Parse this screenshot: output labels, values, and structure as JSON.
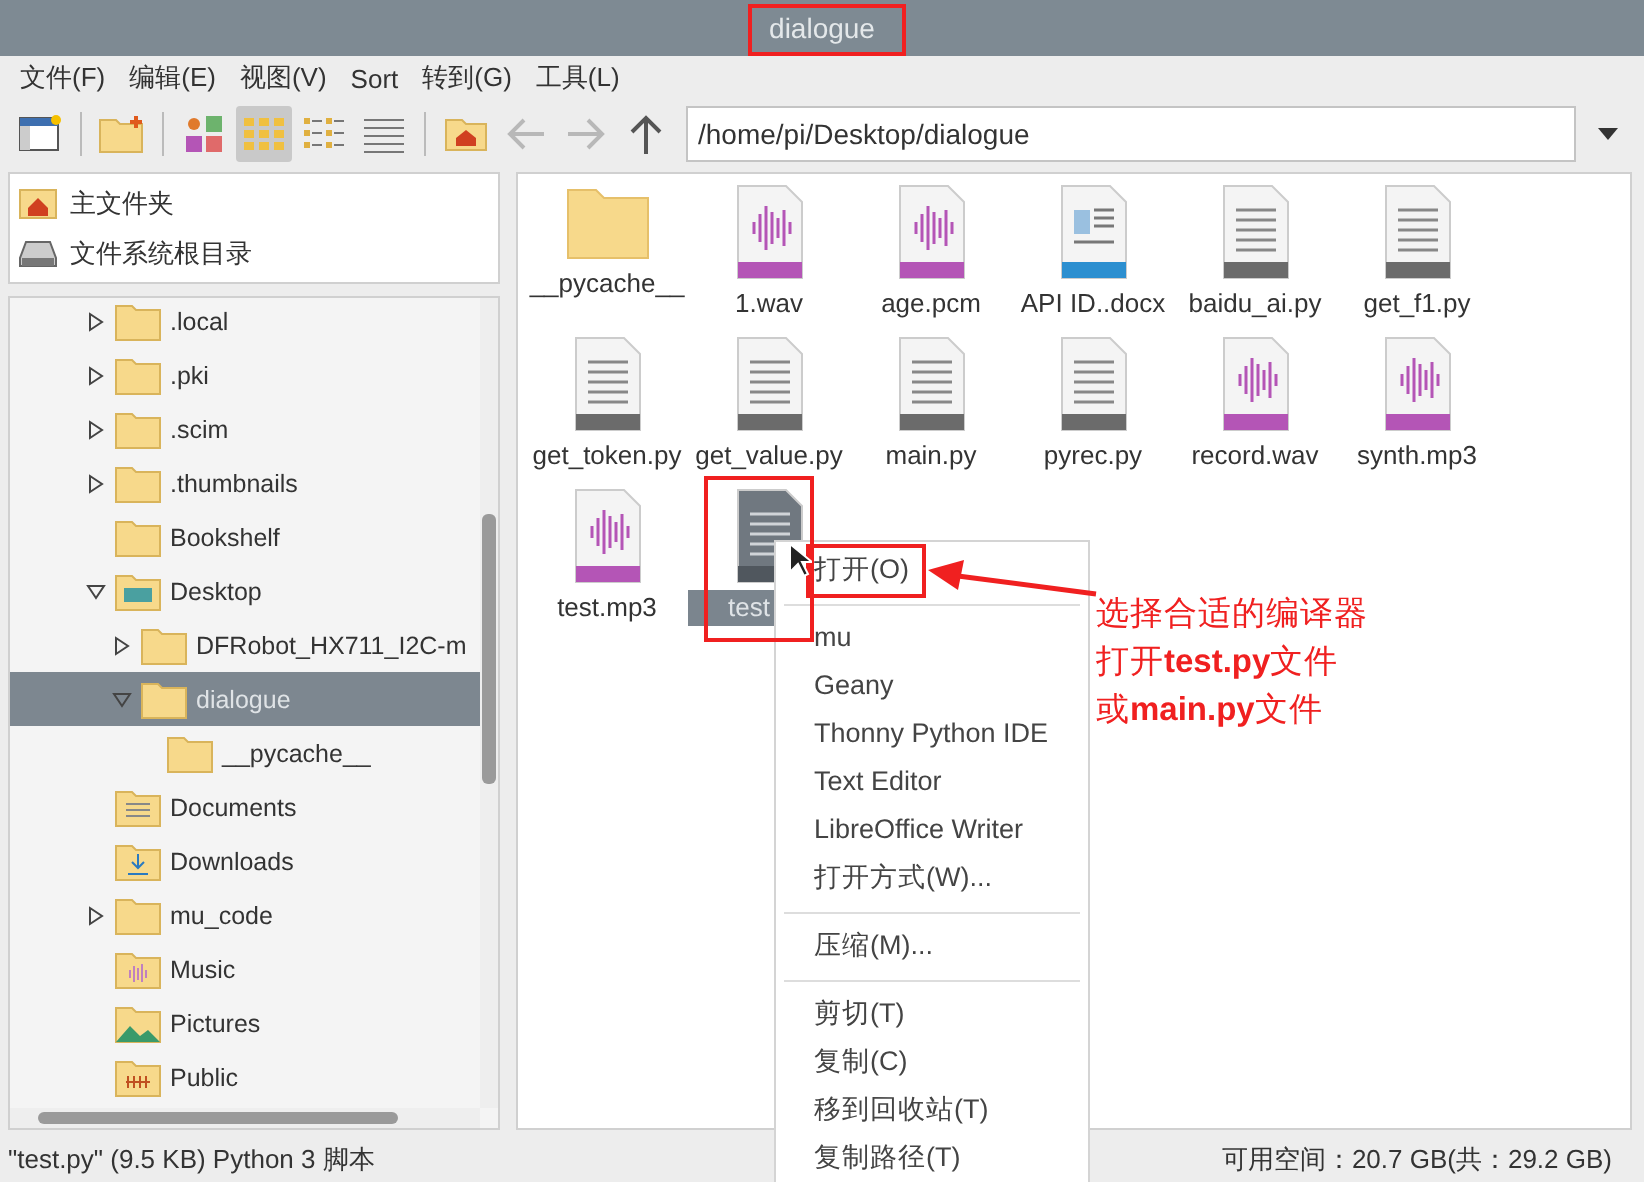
{
  "window": {
    "title": "dialogue"
  },
  "menubar": [
    "文件(F)",
    "编辑(E)",
    "视图(V)",
    "Sort",
    "转到(G)",
    "工具(L)"
  ],
  "toolbar": {
    "view_modes": [
      {
        "kind": "thumbnail",
        "selected": false
      },
      {
        "kind": "icon",
        "selected": true
      },
      {
        "kind": "compact",
        "selected": false
      },
      {
        "kind": "list",
        "selected": false
      }
    ],
    "nav": [
      {
        "kind": "back",
        "disabled": true
      },
      {
        "kind": "forward",
        "disabled": true
      },
      {
        "kind": "up",
        "disabled": false
      }
    ],
    "path": "/home/pi/Desktop/dialogue"
  },
  "places": [
    {
      "label": "主文件夹",
      "kind": "home"
    },
    {
      "label": "文件系统根目录",
      "kind": "drive"
    }
  ],
  "tree": [
    {
      "label": ".local",
      "kind": "folder",
      "expandable": true,
      "expanded": false,
      "selected": false
    },
    {
      "label": ".pki",
      "kind": "folder",
      "expandable": true,
      "expanded": false,
      "selected": false
    },
    {
      "label": ".scim",
      "kind": "folder",
      "expandable": true,
      "expanded": false,
      "selected": false
    },
    {
      "label": ".thumbnails",
      "kind": "folder",
      "expandable": true,
      "expanded": false,
      "selected": false
    },
    {
      "label": "Bookshelf",
      "kind": "folder",
      "expandable": false,
      "expanded": false,
      "selected": false
    },
    {
      "label": "Desktop",
      "kind": "desktop",
      "expandable": true,
      "expanded": true,
      "selected": false,
      "children": [
        {
          "label": "DFRobot_HX711_I2C-m",
          "kind": "folder",
          "expandable": true,
          "expanded": false,
          "selected": false
        },
        {
          "label": "dialogue",
          "kind": "folder",
          "expandable": true,
          "expanded": true,
          "selected": true,
          "children": [
            {
              "label": "__pycache__",
              "kind": "folder",
              "expandable": false,
              "expanded": false,
              "selected": false
            }
          ]
        }
      ]
    },
    {
      "label": "Documents",
      "kind": "documents",
      "expandable": false,
      "expanded": false,
      "selected": false
    },
    {
      "label": "Downloads",
      "kind": "downloads",
      "expandable": false,
      "expanded": false,
      "selected": false
    },
    {
      "label": "mu_code",
      "kind": "folder",
      "expandable": true,
      "expanded": false,
      "selected": false
    },
    {
      "label": "Music",
      "kind": "music",
      "expandable": false,
      "expanded": false,
      "selected": false
    },
    {
      "label": "Pictures",
      "kind": "pictures",
      "expandable": false,
      "expanded": false,
      "selected": false
    },
    {
      "label": "Public",
      "kind": "public",
      "expandable": false,
      "expanded": false,
      "selected": false
    }
  ],
  "files": [
    {
      "name": "__pycache__",
      "kind": "folder",
      "selected": false
    },
    {
      "name": "1.wav",
      "kind": "audio",
      "selected": false
    },
    {
      "name": "age.pcm",
      "kind": "audio",
      "selected": false
    },
    {
      "name": "API ID..docx",
      "kind": "document",
      "selected": false
    },
    {
      "name": "baidu_ai.py",
      "kind": "text",
      "selected": false
    },
    {
      "name": "get_f1.py",
      "kind": "text",
      "selected": false
    },
    {
      "name": "get_token.py",
      "kind": "text",
      "selected": false
    },
    {
      "name": "get_value.py",
      "kind": "text",
      "selected": false
    },
    {
      "name": "main.py",
      "kind": "text",
      "selected": false
    },
    {
      "name": "pyrec.py",
      "kind": "text",
      "selected": false
    },
    {
      "name": "record.wav",
      "kind": "audio",
      "selected": false
    },
    {
      "name": "synth.mp3",
      "kind": "audio",
      "selected": false
    },
    {
      "name": "test.mp3",
      "kind": "audio",
      "selected": false
    },
    {
      "name": "test",
      "kind": "text",
      "selected": true
    }
  ],
  "context_menu": {
    "groups": [
      [
        "打开(O)"
      ],
      [
        "mu",
        "Geany",
        "Thonny Python IDE",
        "Text Editor",
        "LibreOffice Writer",
        "打开方式(W)..."
      ],
      [
        "压缩(M)..."
      ],
      [
        "剪切(T)",
        "复制(C)",
        "移到回收站(T)",
        "复制路径(T)"
      ]
    ]
  },
  "annotation": {
    "lines": [
      "选择合适的编译器",
      "打开**test.py**文件",
      "或**main.py**文件"
    ]
  },
  "status_bar": {
    "selection": "\"test.py\" (9.5 KB) Python 3 脚本",
    "free_space": "可用空间：20.7 GB(共：29.2 GB)"
  }
}
